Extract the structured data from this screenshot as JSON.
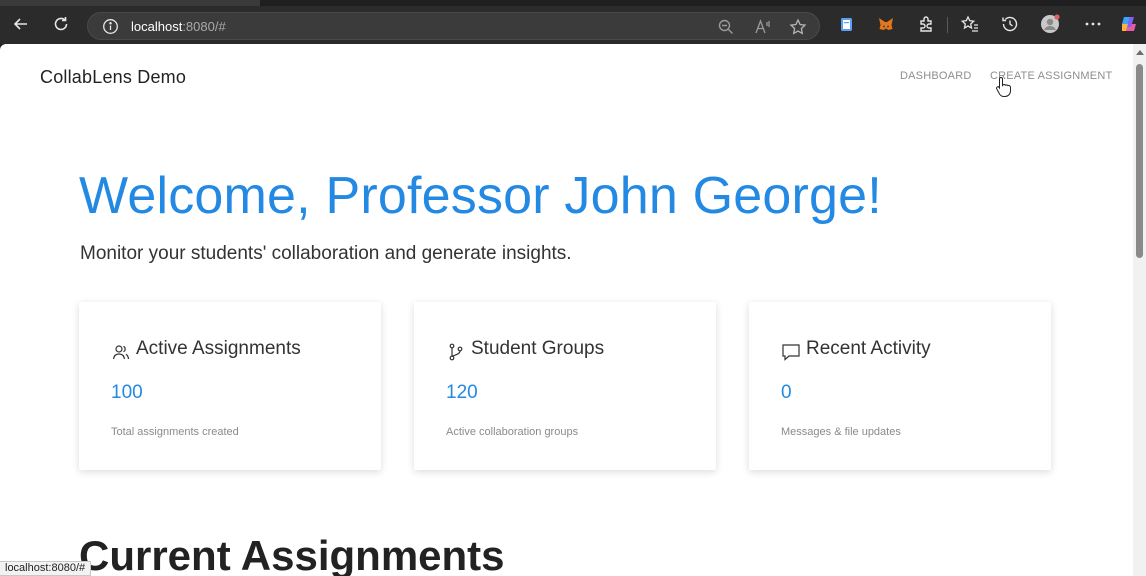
{
  "browser": {
    "url_host": "localhost",
    "url_rest": ":8080/#"
  },
  "header": {
    "brand": "CollabLens Demo",
    "nav": [
      "DASHBOARD",
      "CREATE ASSIGNMENT"
    ]
  },
  "hero": {
    "title": "Welcome, Professor John George!",
    "subtitle": "Monitor your students' collaboration and generate insights."
  },
  "cards": [
    {
      "icon": "users-icon",
      "title": "Active Assignments",
      "value": "100",
      "desc": "Total assignments created"
    },
    {
      "icon": "branch-icon",
      "title": "Student Groups",
      "value": "120",
      "desc": "Active collaboration groups"
    },
    {
      "icon": "chat-icon",
      "title": "Recent Activity",
      "value": "0",
      "desc": "Messages & file updates"
    }
  ],
  "section": {
    "title": "Current Assignments"
  },
  "status": {
    "link": "localhost:8080/#"
  },
  "colors": {
    "accent": "#2389e3",
    "chrome": "#2b2b2b"
  }
}
